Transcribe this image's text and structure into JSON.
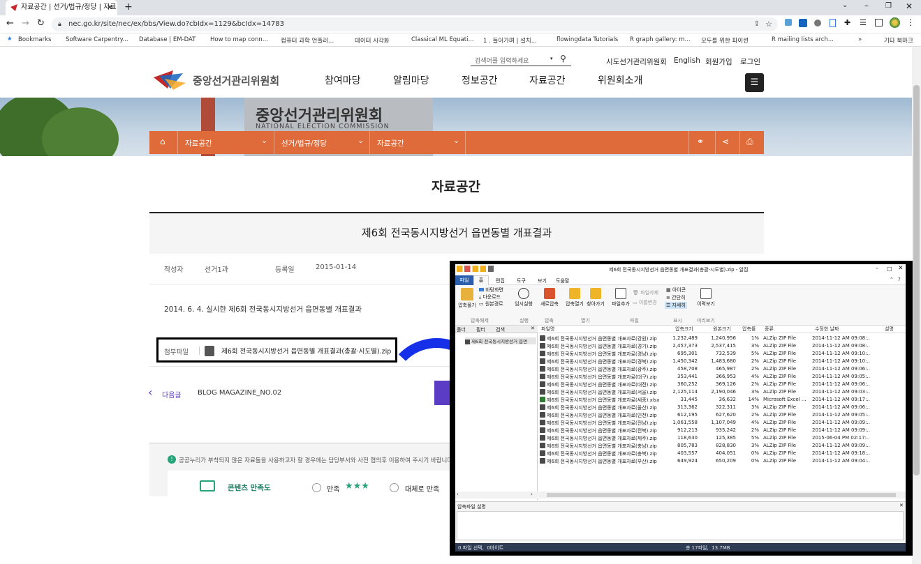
{
  "browser": {
    "tab_title": "자료공간 | 선거/법규/정당 | 자료",
    "url": "nec.go.kr/site/nec/ex/bbs/View.do?cbIdx=1129&bcIdx=14783",
    "bookmarks": [
      "Bookmarks",
      "Software Carpentry...",
      "Database | EM-DAT",
      "How to map conn...",
      "컴퓨터 과학 언플러...",
      "데이터 시각화",
      "Classical ML Equati...",
      "1 . 들어가며 | 설치...",
      "flowingdata Tutorials",
      "R graph gallery: m...",
      "모두를 위한 파이썬",
      "R mailing lists arch..."
    ],
    "other_bookmarks": "기타 북마크"
  },
  "site": {
    "logo_text": "중앙선거관리위원회",
    "search_placeholder": "검색어를 입력하세요",
    "top_links": [
      "시도선거관리위원회",
      "English",
      "회원가입",
      "로그인"
    ],
    "nav": [
      "참여마당",
      "알림마당",
      "정보공간",
      "자료공간",
      "위원회소개"
    ],
    "hero_sign_ko": "중앙선거관리위원회",
    "hero_sign_en": "NATIONAL ELECTION COMMISSION",
    "breadcrumb": [
      "자료공간",
      "선거/법규/정당",
      "자료공간"
    ],
    "page_heading": "자료공간",
    "post_title": "제6회 전국동시지방선거 읍면동별 개표결과",
    "meta": {
      "author_label": "작성자",
      "author": "선거1과",
      "date_label": "등록일",
      "date": "2015-01-14"
    },
    "body_text": "2014. 6. 4. 실시한 제6회 전국동시지방선거 읍면동별 개표결과",
    "attachment_label": "첨부파일",
    "attachment_name": "제6회 전국동시지방선거 읍면동별 개표결과(총괄·시도별).zip",
    "next_label": "다음글",
    "next_title": "BLOG MAGAZINE_NO.02",
    "notice": "공공누리가 부착되지 않은 자료들을 사용하고자 할 경우에는 담당부서와 사전 협의후 이용하여 주시기 바랍니다.",
    "satisfaction_label": "콘텐츠 만족도",
    "options": [
      "만족",
      "대체로 만족"
    ]
  },
  "alzip": {
    "title": "제6회 전국동시지방선거 읍면동별 개표결과(총괄-시도별).zip - 알집",
    "tabs": [
      "파일",
      "홈",
      "편집",
      "도구",
      "보기",
      "도움말"
    ],
    "ribbon": {
      "extract": "압축풀기",
      "view_desktop": "바탕화면",
      "download": "다운로드",
      "orig_path": "원본경로",
      "group_extract": "압축해제",
      "temp_run": "임시실행",
      "group_run": "실행",
      "new_archive": "새로압축",
      "group_compress": "압축",
      "open_archive": "압축열기",
      "find": "찾아가기",
      "group_open": "열기",
      "add_file": "파일추가",
      "delete_file": "파일삭제",
      "rename": "이름변경",
      "group_file": "파일",
      "icons": "아이콘",
      "simple": "간단히",
      "detail": "자세히",
      "group_display": "표시",
      "preview": "이력보기",
      "group_preview": "미리보기"
    },
    "left_tabs": [
      "폴더",
      "필터",
      "검색"
    ],
    "tree_item": "제6회 전국동시지방선거 읍면",
    "columns": [
      "파일명",
      "압축크기",
      "원본크기",
      "압축률",
      "종류",
      "수정한 날짜",
      "설명"
    ],
    "files": [
      {
        "name": "제6회 전국동시지방선거 읍면동별 개표자료(강원).zip",
        "csize": "1,232,489",
        "osize": "1,240,956",
        "ratio": "1%",
        "type": "ALZip ZIP File",
        "date": "2014-11-12 AM 09:08:..",
        "icon": "zip"
      },
      {
        "name": "제6회 전국동시지방선거 읍면동별 개표자료(경기).zip",
        "csize": "2,457,373",
        "osize": "2,537,415",
        "ratio": "3%",
        "type": "ALZip ZIP File",
        "date": "2014-11-12 AM 09:08:..",
        "icon": "zip"
      },
      {
        "name": "제6회 전국동시지방선거 읍면동별 개표자료(경남).zip",
        "csize": "695,301",
        "osize": "732,539",
        "ratio": "5%",
        "type": "ALZip ZIP File",
        "date": "2014-11-12 AM 09:10:..",
        "icon": "zip"
      },
      {
        "name": "제6회 전국동시지방선거 읍면동별 개표자료(경북).zip",
        "csize": "1,450,342",
        "osize": "1,483,680",
        "ratio": "2%",
        "type": "ALZip ZIP File",
        "date": "2014-11-12 AM 09:10:..",
        "icon": "zip"
      },
      {
        "name": "제6회 전국동시지방선거 읍면동별 개표자료(광주).zip",
        "csize": "458,708",
        "osize": "465,987",
        "ratio": "2%",
        "type": "ALZip ZIP File",
        "date": "2014-11-12 AM 09:06:..",
        "icon": "zip"
      },
      {
        "name": "제6회 전국동시지방선거 읍면동별 개표자료(대구).zip",
        "csize": "353,441",
        "osize": "366,953",
        "ratio": "4%",
        "type": "ALZip ZIP File",
        "date": "2014-11-12 AM 09:05:..",
        "icon": "zip"
      },
      {
        "name": "제6회 전국동시지방선거 읍면동별 개표자료(대전).zip",
        "csize": "360,252",
        "osize": "369,126",
        "ratio": "2%",
        "type": "ALZip ZIP File",
        "date": "2014-11-12 AM 09:06:..",
        "icon": "zip"
      },
      {
        "name": "제6회 전국동시지방선거 읍면동별 개표자료(서울).zip",
        "csize": "2,125,114",
        "osize": "2,190,046",
        "ratio": "3%",
        "type": "ALZip ZIP File",
        "date": "2014-11-12 AM 09:03:..",
        "icon": "zip"
      },
      {
        "name": "제6회 전국동시지방선거 읍면동별 개표자료(세종).xlsx",
        "csize": "31,445",
        "osize": "36,632",
        "ratio": "14%",
        "type": "Microsoft Excel ...",
        "date": "2014-11-12 AM 09:17:..",
        "icon": "xls"
      },
      {
        "name": "제6회 전국동시지방선거 읍면동별 개표자료(울산).zip",
        "csize": "313,362",
        "osize": "322,311",
        "ratio": "3%",
        "type": "ALZip ZIP File",
        "date": "2014-11-12 AM 09:06:..",
        "icon": "zip"
      },
      {
        "name": "제6회 전국동시지방선거 읍면동별 개표자료(인천).zip",
        "csize": "612,195",
        "osize": "627,620",
        "ratio": "2%",
        "type": "ALZip ZIP File",
        "date": "2014-11-12 AM 09:05:..",
        "icon": "zip"
      },
      {
        "name": "제6회 전국동시지방선거 읍면동별 개표자료(전남).zip",
        "csize": "1,061,558",
        "osize": "1,107,049",
        "ratio": "4%",
        "type": "ALZip ZIP File",
        "date": "2014-11-12 AM 09:09:..",
        "icon": "zip"
      },
      {
        "name": "제6회 전국동시지방선거 읍면동별 개표자료(전북).zip",
        "csize": "912,213",
        "osize": "935,242",
        "ratio": "2%",
        "type": "ALZip ZIP File",
        "date": "2014-11-12 AM 09:09:..",
        "icon": "zip"
      },
      {
        "name": "제6회 전국동시지방선거 읍면동별 개표자료(제주).zip",
        "csize": "118,630",
        "osize": "125,385",
        "ratio": "5%",
        "type": "ALZip ZIP File",
        "date": "2015-06-04 PM 02:17:..",
        "icon": "zip"
      },
      {
        "name": "제6회 전국동시지방선거 읍면동별 개표자료(충남).zip",
        "csize": "805,783",
        "osize": "828,830",
        "ratio": "3%",
        "type": "ALZip ZIP File",
        "date": "2014-11-12 AM 09:09:..",
        "icon": "zip"
      },
      {
        "name": "제6회 전국동시지방선거 읍면동별 개표자료(충북).zip",
        "csize": "403,557",
        "osize": "404,051",
        "ratio": "0%",
        "type": "ALZip ZIP File",
        "date": "2014-11-12 AM 09:18:..",
        "icon": "zip"
      },
      {
        "name": "제6회 전국동시지방선거 읍면동별 개표자료(부산).zip",
        "csize": "649,924",
        "osize": "650,209",
        "ratio": "0%",
        "type": "ALZip ZIP File",
        "date": "2014-11-12 AM 09:04:..",
        "icon": "zip"
      }
    ],
    "desc_panel": "압축파일 설명",
    "status_left": "0 파일 선택,  0바이트",
    "status_right": "총 17파일,  13.7MB"
  }
}
